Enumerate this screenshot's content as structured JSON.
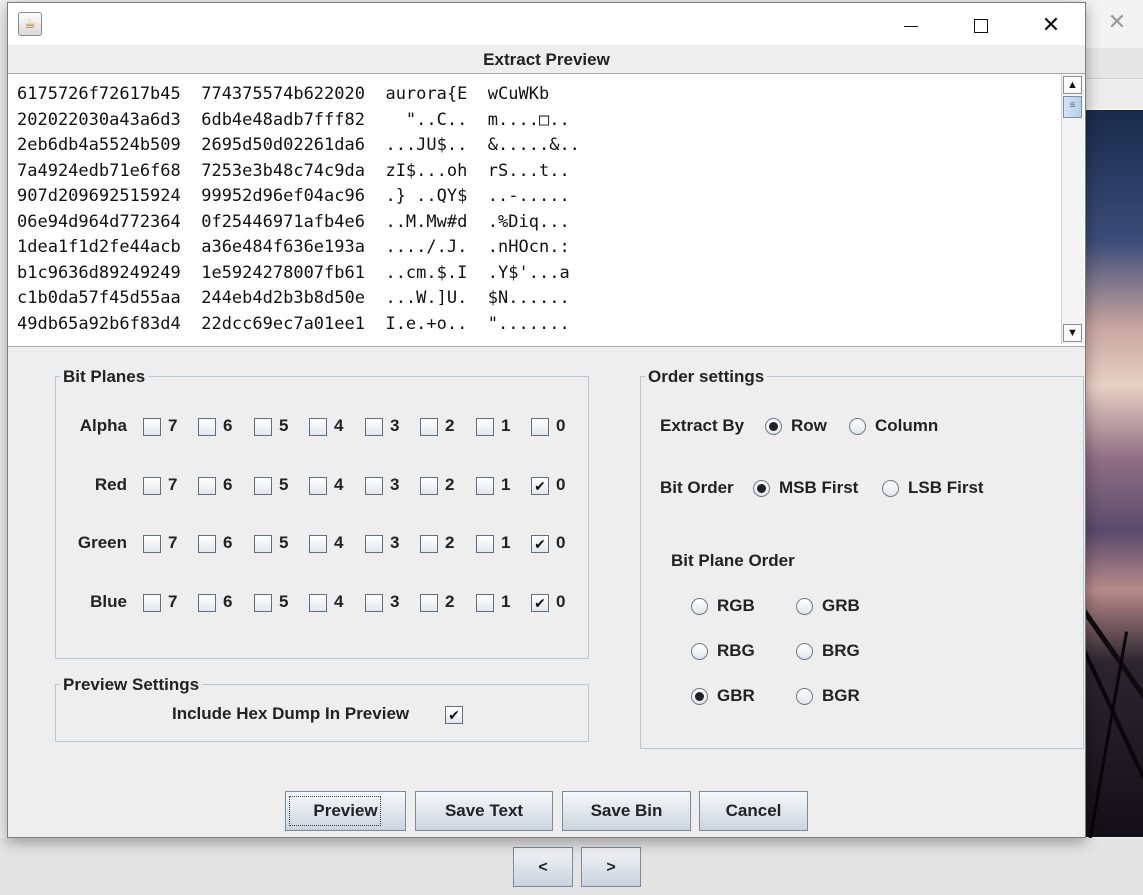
{
  "dialog": {
    "title": "Extract Preview"
  },
  "preview": {
    "lines": [
      "6175726f72617b45  774375574b622020  aurora{E  wCuWKb",
      "202022030a43a6d3  6db4e48adb7fff82    \"..C..  m....□..",
      "2eb6db4a5524b509  2695d50d02261da6  ...JU$..  &.....&..",
      "7a4924edb71e6f68  7253e3b48c74c9da  zI$...oh  rS...t..",
      "907d209692515924  99952d96ef04ac96  .} ..QY$  ..-.....",
      "06e94d964d772364  0f25446971afb4e6  ..M.Mw#d  .%Diq...",
      "1dea1f1d2fe44acb  a36e484f636e193a  ..../.J.  .nHOcn.:",
      "b1c9636d89249249  1e5924278007fb61  ..cm.$.I  .Y$'...a",
      "c1b0da57f45d55aa  244eb4d2b3b8d50e  ...W.]U.  $N......",
      "49db65a92b6f83d4  22dcc69ec7a01ee1  I.e.+o..  \"......."
    ]
  },
  "bit_planes": {
    "title": "Bit Planes",
    "bits": [
      "7",
      "6",
      "5",
      "4",
      "3",
      "2",
      "1",
      "0"
    ],
    "rows": [
      {
        "label": "Alpha",
        "checked": [
          false,
          false,
          false,
          false,
          false,
          false,
          false,
          false
        ]
      },
      {
        "label": "Red",
        "checked": [
          false,
          false,
          false,
          false,
          false,
          false,
          false,
          true
        ]
      },
      {
        "label": "Green",
        "checked": [
          false,
          false,
          false,
          false,
          false,
          false,
          false,
          true
        ]
      },
      {
        "label": "Blue",
        "checked": [
          false,
          false,
          false,
          false,
          false,
          false,
          false,
          true
        ]
      }
    ]
  },
  "preview_settings": {
    "title": "Preview Settings",
    "hex_dump_label": "Include Hex Dump In Preview",
    "hex_dump_checked": true
  },
  "order_settings": {
    "title": "Order settings",
    "extract_by_label": "Extract By",
    "extract_by_options": [
      "Row",
      "Column"
    ],
    "extract_by_selected": "Row",
    "bit_order_label": "Bit Order",
    "bit_order_options": [
      "MSB First",
      "LSB First"
    ],
    "bit_order_selected": "MSB First",
    "bit_plane_order_label": "Bit Plane Order",
    "bit_plane_order_options": [
      "RGB",
      "GRB",
      "RBG",
      "BRG",
      "GBR",
      "BGR"
    ],
    "bit_plane_order_selected": "GBR"
  },
  "buttons": {
    "preview": "Preview",
    "save_text": "Save Text",
    "save_bin": "Save Bin",
    "cancel": "Cancel"
  },
  "background_app": {
    "prev_label": "<",
    "next_label": ">"
  },
  "icons": {
    "app": "java-cup-icon",
    "check": "✔",
    "close": "✕"
  }
}
